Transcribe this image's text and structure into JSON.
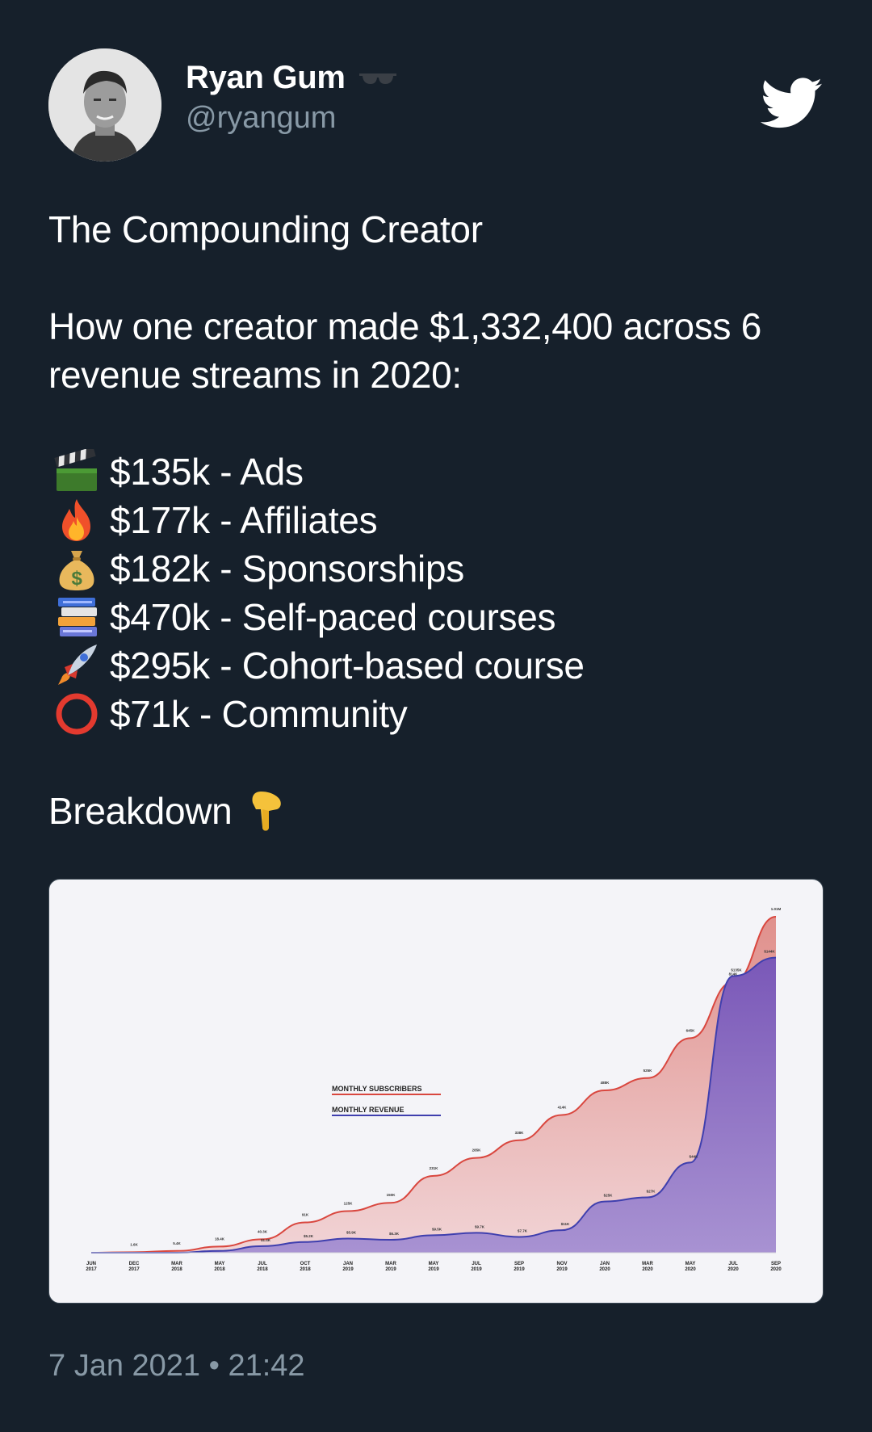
{
  "author": {
    "display_name": "Ryan Gum",
    "handle": "@ryangum",
    "badge_icon": "sunglasses-icon"
  },
  "tweet": {
    "title": "The Compounding Creator",
    "intro": "How one creator made $1,332,400 across 6 revenue streams in 2020:",
    "streams": [
      {
        "icon": "clapper-board-icon",
        "text": "$135k - Ads"
      },
      {
        "icon": "fire-icon",
        "text": "$177k - Affiliates"
      },
      {
        "icon": "money-bag-icon",
        "text": "$182k - Sponsorships"
      },
      {
        "icon": "books-icon",
        "text": "$470k - Self-paced courses"
      },
      {
        "icon": "rocket-icon",
        "text": "$295k - Cohort-based course"
      },
      {
        "icon": "hollow-red-circle-icon",
        "text": "$71k - Community"
      }
    ],
    "breakdown": "Breakdown",
    "breakdown_icon": "pointing-down-icon",
    "timestamp": "7 Jan 2021 • 21:42"
  },
  "colors": {
    "background": "#16202b",
    "subscribers": "#d9473f",
    "revenue": "#3f3fae"
  },
  "chart_data": {
    "type": "area",
    "legend": [
      "MONTHLY SUBSCRIBERS",
      "MONTHLY REVENUE"
    ],
    "legend_position": "center-left",
    "x_tick_labels": [
      "JUN 2017",
      "DEC 2017",
      "MAR 2018",
      "MAY 2018",
      "JUL 2018",
      "OCT 2018",
      "JAN 2019",
      "MAR 2019",
      "MAY 2019",
      "JUL 2019",
      "SEP 2019",
      "NOV 2019",
      "JAN 2020",
      "MAR 2020",
      "MAY 2020",
      "JUL 2020",
      "SEP 2020"
    ],
    "series": [
      {
        "name": "MONTHLY SUBSCRIBERS",
        "values": [
          0,
          1.6,
          5.4,
          18.4,
          40.3,
          91,
          125,
          150,
          231,
          285,
          338,
          414,
          488,
          525,
          645,
          814,
          1010
        ],
        "labels": [
          "",
          "1.6K",
          "5.4K",
          "18.4K",
          "40.3K",
          "91K",
          "125K",
          "150K",
          "231K",
          "285K",
          "338K",
          "414K",
          "488K",
          "525K",
          "645K",
          "814K",
          "1.01M"
        ]
      },
      {
        "name": "MONTHLY REVENUE",
        "values": [
          0,
          0,
          0,
          0.9,
          3.2,
          5.2,
          6.9,
          6.3,
          8.5,
          9.7,
          7.7,
          11,
          25,
          27,
          44,
          135,
          144
        ],
        "labels": [
          "",
          "",
          "",
          "",
          "$1.4K",
          "$5.2K",
          "$5.9K",
          "$6.3K",
          "$9.5K",
          "$9.7K",
          "$7.7K",
          "$11K",
          "$25K",
          "$27K",
          "$44K",
          "$135K",
          "$144K"
        ]
      }
    ]
  }
}
